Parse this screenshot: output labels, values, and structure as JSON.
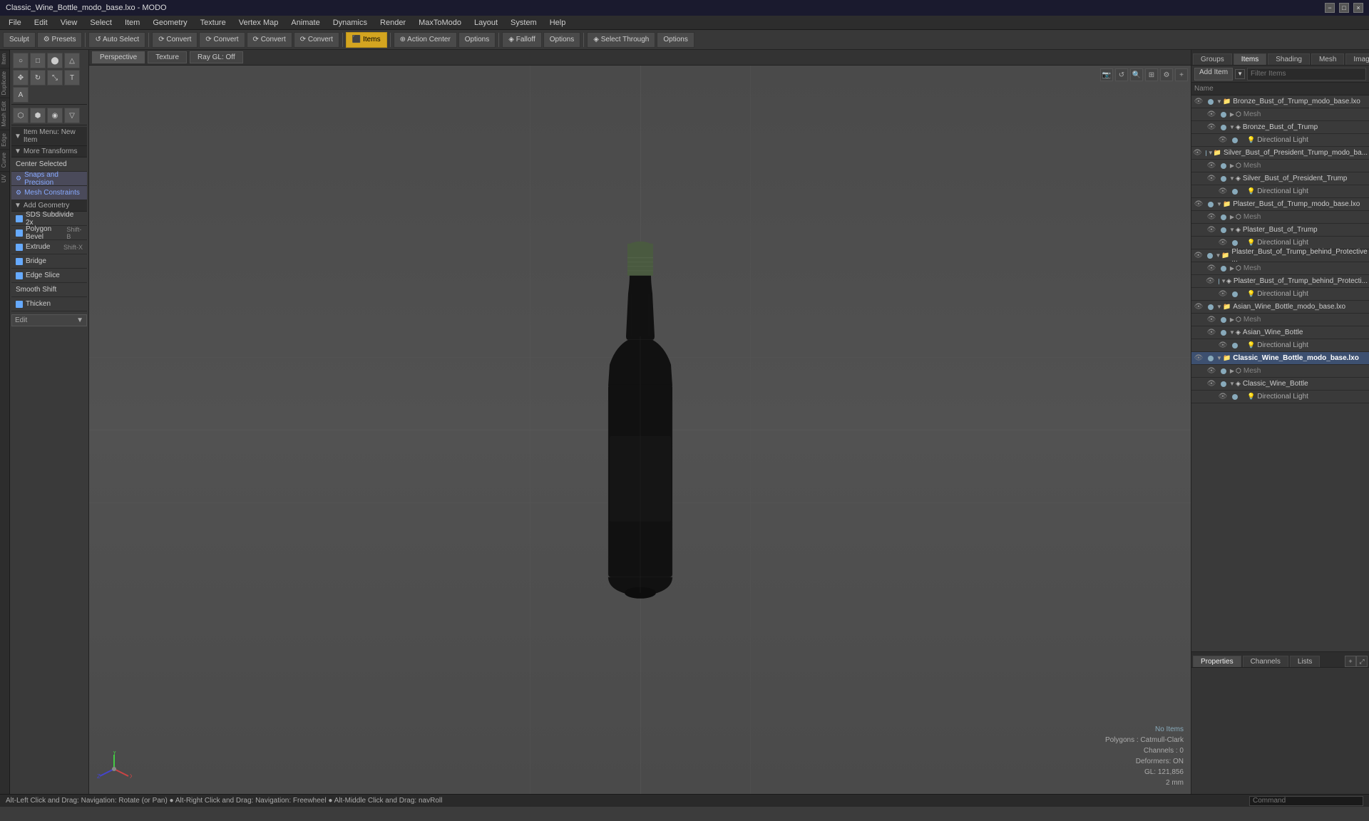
{
  "titlebar": {
    "title": "Classic_Wine_Bottle_modo_base.lxo - MODO",
    "controls": [
      "−",
      "□",
      "×"
    ]
  },
  "menubar": {
    "items": [
      "File",
      "Edit",
      "View",
      "Select",
      "Item",
      "Geometry",
      "Texture",
      "Vertex Map",
      "Animate",
      "Dynamics",
      "Render",
      "MaxToModo",
      "Layout",
      "System",
      "Help"
    ]
  },
  "toolbar": {
    "sculpt_label": "Sculpt",
    "presets_label": "⚙ Presets",
    "buttons": [
      {
        "label": "↺ Auto Select",
        "active": false
      },
      {
        "label": "⟳ Convert",
        "active": false
      },
      {
        "label": "⟳ Convert",
        "active": false
      },
      {
        "label": "⟳ Convert",
        "active": false
      },
      {
        "label": "⟳ Convert",
        "active": false
      },
      {
        "label": "Items",
        "active": true
      },
      {
        "label": "Action Center",
        "active": false
      },
      {
        "label": "Options",
        "active": false
      },
      {
        "label": "⌖ Falloff",
        "active": false
      },
      {
        "label": "Options",
        "active": false
      },
      {
        "label": "◈ Select Through",
        "active": false
      },
      {
        "label": "Options",
        "active": false
      }
    ]
  },
  "left_tabs": [
    "Item",
    "Duplicate",
    "Mesh Edit",
    "Edge",
    "Curve",
    "UV"
  ],
  "left_tools": {
    "top_icons": [
      "circle",
      "cube",
      "sphere",
      "triangle",
      "circle2",
      "edit1",
      "edit2",
      "type1",
      "type2"
    ],
    "item_menu": "Item Menu: New Item",
    "transform_label": "More Transforms",
    "center_label": "Center Selected",
    "add_geo_label": "Add Geometry",
    "tools": [
      {
        "label": "SDS Subdivide 2x",
        "shortcut": "",
        "icon": "blue"
      },
      {
        "label": "Polygon Bevel",
        "shortcut": "Shift-B",
        "icon": "blue"
      },
      {
        "label": "Extrude",
        "shortcut": "Shift-X",
        "icon": "blue"
      },
      {
        "label": "Bridge",
        "shortcut": "",
        "icon": "blue"
      },
      {
        "label": "Edge Slice",
        "shortcut": "",
        "icon": "blue"
      },
      {
        "label": "Smooth Shift",
        "shortcut": "",
        "icon": ""
      },
      {
        "label": "Thicken",
        "shortcut": "",
        "icon": "blue"
      }
    ],
    "snaps_label": "Snaps and Precision",
    "mesh_constraints_label": "Mesh Constraints",
    "edit_label": "Edit"
  },
  "viewport": {
    "tabs": [
      "Perspective",
      "Texture",
      "Ray GL: Off"
    ],
    "status": {
      "no_items": "No Items",
      "polygons": "Polygons : Catmull-Clark",
      "channels": "Channels : 0",
      "deformers": "Deformers: ON",
      "gl": "GL: 121,856",
      "unit": "2 mm"
    },
    "overlay_buttons": [
      "🔲",
      "↺",
      "🔍",
      "📐",
      "⚙",
      "+"
    ]
  },
  "right_panel": {
    "tabs": [
      "Groups",
      "Items",
      "Shading",
      "Mesh",
      "Images"
    ],
    "active_tab": "Items",
    "add_item_label": "Add Item",
    "filter_placeholder": "Filter Items",
    "column_header": "Name",
    "items": [
      {
        "level": 0,
        "label": "Bronze_Bust_of_Trump_modo_base.lxo",
        "type": "file",
        "expanded": true,
        "vis": true
      },
      {
        "level": 1,
        "label": "Mesh",
        "type": "mesh",
        "expanded": false,
        "vis": true
      },
      {
        "level": 1,
        "label": "Bronze_Bust_of_Trump",
        "type": "item",
        "expanded": true,
        "vis": true
      },
      {
        "level": 2,
        "label": "Directional Light",
        "type": "light",
        "expanded": false,
        "vis": true
      },
      {
        "level": 0,
        "label": "Silver_Bust_of_President_Trump_modo_ba...",
        "type": "file",
        "expanded": true,
        "vis": true
      },
      {
        "level": 1,
        "label": "Mesh",
        "type": "mesh",
        "expanded": false,
        "vis": true
      },
      {
        "level": 1,
        "label": "Silver_Bust_of_President_Trump",
        "type": "item",
        "expanded": true,
        "vis": true
      },
      {
        "level": 2,
        "label": "Directional Light",
        "type": "light",
        "expanded": false,
        "vis": true
      },
      {
        "level": 0,
        "label": "Plaster_Bust_of_Trump_modo_base.lxo",
        "type": "file",
        "expanded": true,
        "vis": true
      },
      {
        "level": 1,
        "label": "Mesh",
        "type": "mesh",
        "expanded": false,
        "vis": true
      },
      {
        "level": 1,
        "label": "Plaster_Bust_of_Trump",
        "type": "item",
        "expanded": true,
        "vis": true
      },
      {
        "level": 2,
        "label": "Directional Light",
        "type": "light",
        "expanded": false,
        "vis": true
      },
      {
        "level": 0,
        "label": "Plaster_Bust_of_Trump_behind_Protective...",
        "type": "file",
        "expanded": true,
        "vis": true
      },
      {
        "level": 1,
        "label": "Mesh",
        "type": "mesh",
        "expanded": false,
        "vis": true
      },
      {
        "level": 1,
        "label": "Plaster_Bust_of_Trump_behind_Protecti...",
        "type": "item",
        "expanded": true,
        "vis": true
      },
      {
        "level": 2,
        "label": "Directional Light",
        "type": "light",
        "expanded": false,
        "vis": true
      },
      {
        "level": 0,
        "label": "Asian_Wine_Bottle_modo_base.lxo",
        "type": "file",
        "expanded": true,
        "vis": true
      },
      {
        "level": 1,
        "label": "Mesh",
        "type": "mesh",
        "expanded": false,
        "vis": true
      },
      {
        "level": 1,
        "label": "Asian_Wine_Bottle",
        "type": "item",
        "expanded": true,
        "vis": true
      },
      {
        "level": 2,
        "label": "Directional Light",
        "type": "light",
        "expanded": false,
        "vis": true
      },
      {
        "level": 0,
        "label": "Classic_Wine_Bottle_modo_base.lxo",
        "type": "file",
        "expanded": true,
        "vis": true,
        "active": true
      },
      {
        "level": 1,
        "label": "Mesh",
        "type": "mesh",
        "expanded": false,
        "vis": true
      },
      {
        "level": 1,
        "label": "Classic_Wine_Bottle",
        "type": "item",
        "expanded": true,
        "vis": true
      },
      {
        "level": 2,
        "label": "Directional Light",
        "type": "light",
        "expanded": false,
        "vis": true
      }
    ]
  },
  "properties_panel": {
    "tabs": [
      "Properties",
      "Channels",
      "Lists"
    ],
    "active_tab": "Properties",
    "plus_label": "+",
    "expand_label": "⤢"
  },
  "statusbar": {
    "message": "Alt-Left Click and Drag: Navigation: Rotate (or Pan) ● Alt-Right Click and Drag: Navigation: Freewheel ● Alt-Middle Click and Drag: navRoll",
    "command_placeholder": "Command"
  }
}
